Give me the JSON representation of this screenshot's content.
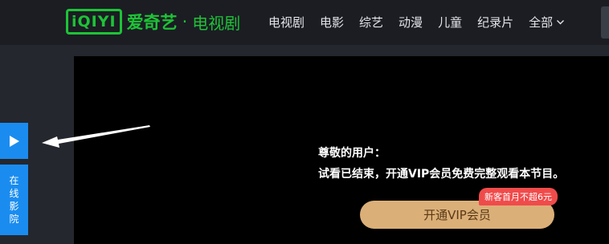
{
  "logo": {
    "mark": "iQIYI",
    "brand": "爱奇艺",
    "separator": "·",
    "section": "电视剧"
  },
  "nav": {
    "items": [
      "电视剧",
      "电影",
      "综艺",
      "动漫",
      "儿童",
      "纪录片"
    ],
    "all_label": "全部"
  },
  "player": {
    "message_line1": "尊敬的用户：",
    "message_line2": "试看已结束，开通VIP会员免费完整观看本节目。",
    "vip_button": "开通VIP会员",
    "promo_badge": "新客首月不超6元"
  },
  "sidebar": {
    "play_icon": "play-icon",
    "cinema_chars": [
      "在",
      "线",
      "影",
      "院"
    ]
  },
  "colors": {
    "brand_green": "#1ec337",
    "vip_gold": "#dbaf78",
    "promo_red": "#f04b4b",
    "side_blue": "#1a8cf0"
  }
}
